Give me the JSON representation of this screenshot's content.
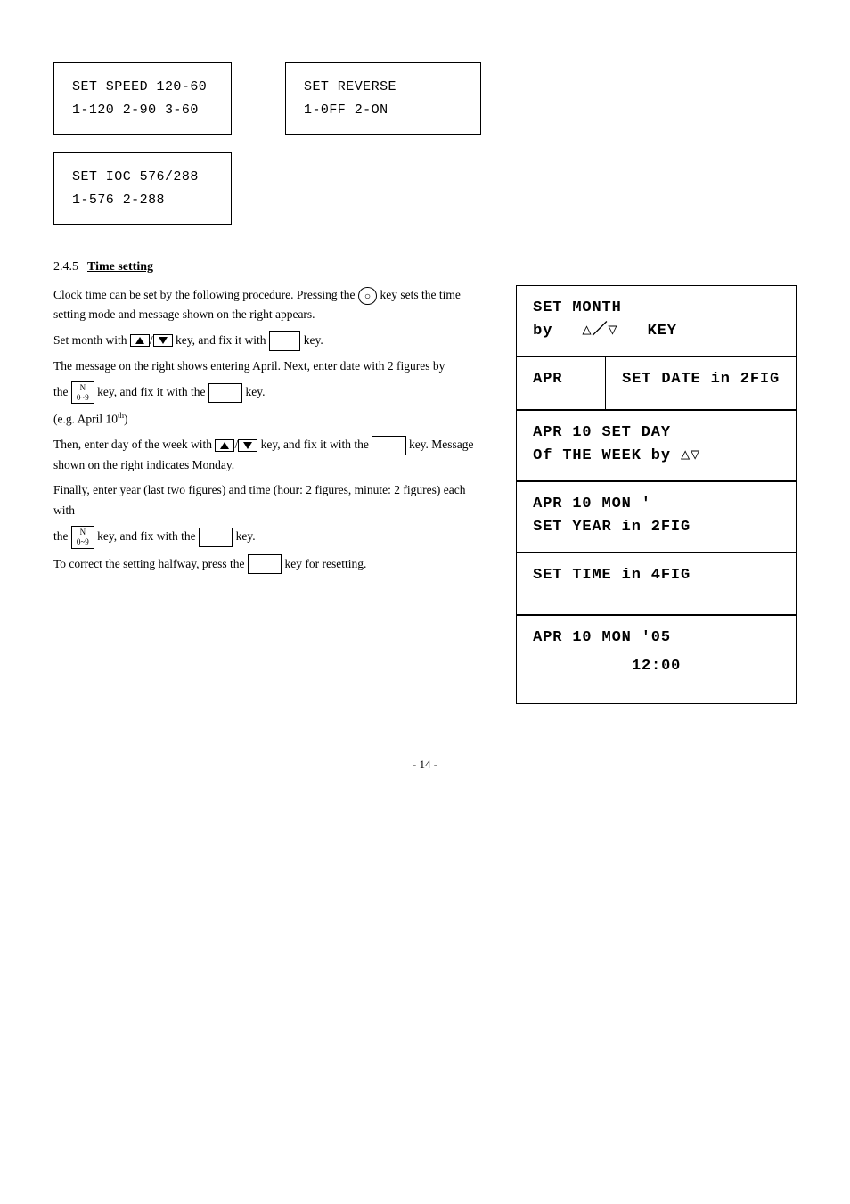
{
  "top_boxes": [
    {
      "id": "speed-box",
      "line1": "SET   SPEED  120-60",
      "line2": "1-120   2-90   3-60"
    },
    {
      "id": "reverse-box",
      "line1": "SET   REVERSE",
      "line2": "1-0FF        2-ON"
    },
    {
      "id": "ioc-box",
      "line1": "SET   IOC   576/288",
      "line2": "1-576        2-288"
    }
  ],
  "section": {
    "number": "2.4.5",
    "title": "Time setting"
  },
  "body_text": {
    "para1": "Clock time can be set by the following procedure. Pressing the",
    "para1b": "key sets the time setting mode and message shown on the right appears.",
    "para2": "Set month with",
    "para2b": "key, and fix it",
    "para2c": "with",
    "para2d": "key.",
    "para3": "The message on the right shows entering April.   Next, enter date with 2 figures by",
    "para3b": "the",
    "para3c": "key, and fix it with the",
    "para3d": "key.",
    "para3e": "(e.g. April 10",
    "para3f": "th",
    "para3g": ")",
    "para4": "Then, enter day of the week with",
    "para4b": "key, and fix it with the",
    "para4c": "key.  Message shown on the right indicates Monday.",
    "para5": "Finally, enter year (last two figures) and time (hour: 2 figures, minute: 2 figures) each with",
    "para5b": "the",
    "para5c": "key, and fix with the",
    "para5d": "key.",
    "para6": "To correct the setting halfway, press the",
    "para6b": "key for resetting."
  },
  "display_boxes": [
    {
      "id": "set-month-box",
      "line1": "SET   MONTH",
      "line2": "by   △／▽   KEY"
    },
    {
      "id": "apr-box",
      "line1": "APR",
      "line2": ""
    },
    {
      "id": "set-date-box",
      "line1": "SET   DATE   in   2FIG",
      "line2": ""
    },
    {
      "id": "apr-10-set-day-box",
      "line1": "APR   10   SET   DAY",
      "line2": "Of  THE  WEEK  by  △▽"
    },
    {
      "id": "apr-10-mon-box",
      "line1": "APR   10   MON   '",
      "line2": "SET   YEAR   in   2FIG"
    },
    {
      "id": "set-time-box",
      "line1": "SET   TIME   in   4FIG",
      "line2": ""
    },
    {
      "id": "apr-10-mon05-box",
      "line1": "APR   10   MON '05",
      "line2": "         12:00"
    }
  ],
  "page_number": "- 14 -"
}
